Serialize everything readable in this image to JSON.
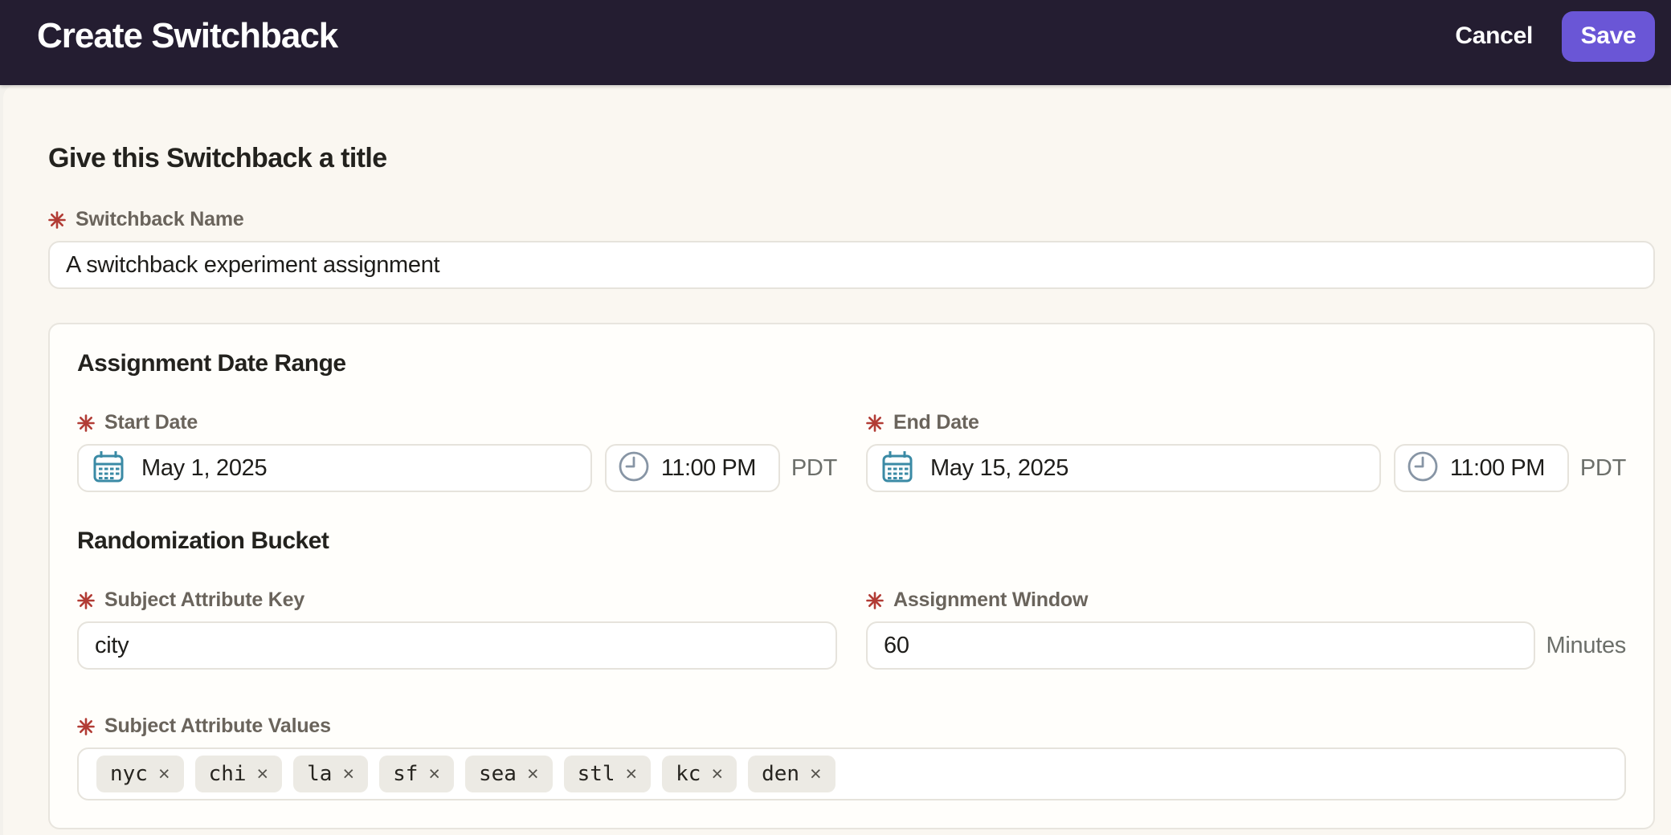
{
  "header": {
    "title": "Create Switchback",
    "cancel_label": "Cancel",
    "save_label": "Save"
  },
  "form": {
    "section_title": "Give this Switchback a title",
    "name_field": {
      "label": "Switchback Name",
      "required": true,
      "value": "A switchback experiment assignment"
    },
    "card": {
      "date_range_title": "Assignment Date Range",
      "start_date": {
        "label": "Start Date",
        "required": true,
        "date": "May 1, 2025",
        "time": "11:00 PM",
        "timezone": "PDT"
      },
      "end_date": {
        "label": "End Date",
        "required": true,
        "date": "May 15, 2025",
        "time": "11:00 PM",
        "timezone": "PDT"
      },
      "randomization_title": "Randomization Bucket",
      "subject_attribute_key": {
        "label": "Subject Attribute Key",
        "required": true,
        "value": "city"
      },
      "assignment_window": {
        "label": "Assignment Window",
        "required": true,
        "value": "60",
        "unit": "Minutes"
      },
      "subject_attribute_values": {
        "label": "Subject Attribute Values",
        "required": true,
        "tags": [
          "nyc",
          "chi",
          "la",
          "sf",
          "sea",
          "stl",
          "kc",
          "den"
        ],
        "remove_symbol": "×"
      }
    }
  },
  "colors": {
    "header_bg": "#241d31",
    "save_button": "#6a56d6",
    "panel_bg": "#faf7f1",
    "card_bg": "#fffefb",
    "border": "#e6e3dc",
    "heading_text": "#23221e",
    "label_text": "#6a645c",
    "required_asterisk": "#b23c35",
    "calendar_icon": "#3a8aa5",
    "clock_icon": "#8795a5",
    "tag_bg": "#eceae4"
  },
  "icons": {
    "calendar": "calendar-icon",
    "clock": "clock-icon",
    "required": "required-asterisk-icon",
    "remove": "remove-tag-icon"
  }
}
